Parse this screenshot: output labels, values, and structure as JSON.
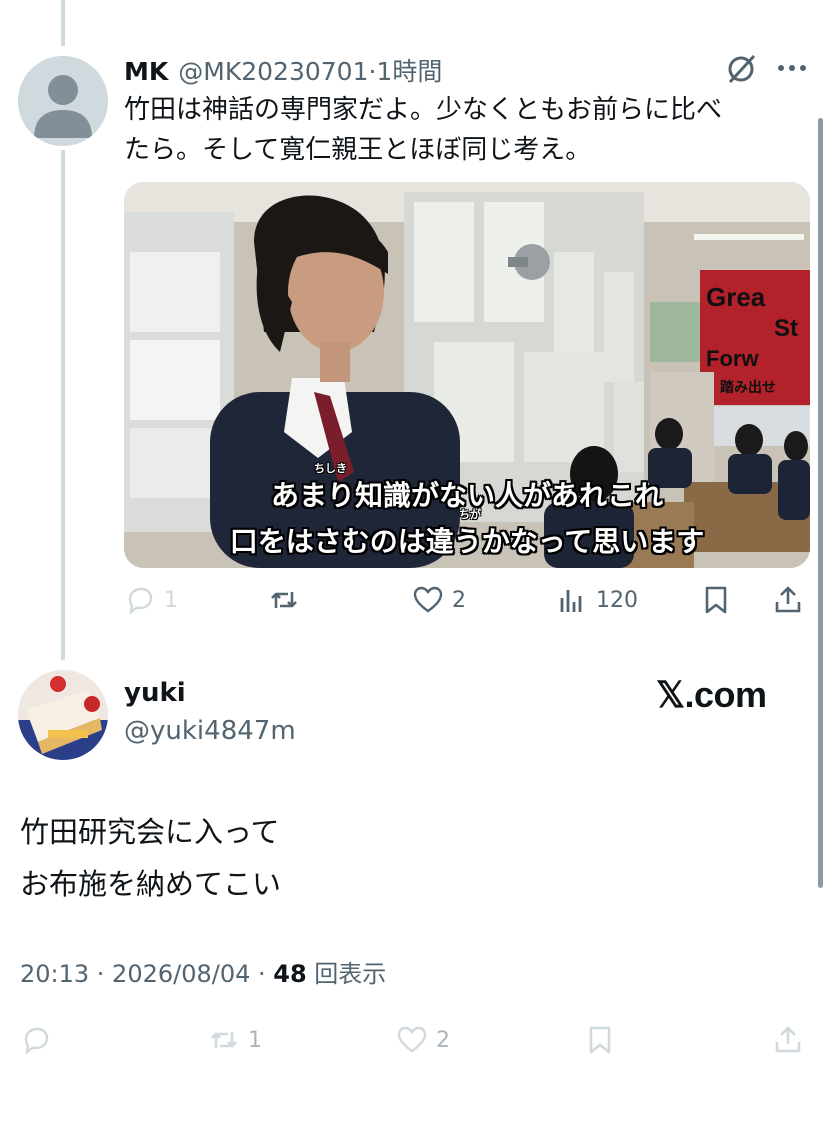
{
  "reply": {
    "name": "MK",
    "handle": "@MK20230701",
    "separator": "·",
    "time": "1時間",
    "text_line1": "竹田は神話の専門家だよ。少なくともお前らに比べ",
    "text_line2": "たら。そして寛仁親王とほぼ同じ考え。",
    "media": {
      "subtitle_line1": "あまり知識がない人があれこれ",
      "subtitle_line2": "口をはさむのは違うかなって思います",
      "ruby_chishiki": "ちしき",
      "ruby_chiga": "ちが",
      "banner_text1": "Grea",
      "banner_text2": "St",
      "banner_text3": "Forw",
      "banner_text4": "踏み出せ"
    },
    "actions": {
      "reply_count": "1",
      "repost_count": "",
      "like_count": "2",
      "views_count": "120"
    }
  },
  "original": {
    "name": "yuki",
    "handle": "@yuki4847m",
    "watermark": "𝕏.com",
    "text_line1": "竹田研究会に入って",
    "text_line2": "お布施を納めてこい",
    "time": "20:13 · 2026/08/04 · ",
    "views_number": "48",
    "views_label": " 回表示",
    "actions": {
      "repost_count": "1",
      "like_count": "2"
    }
  },
  "icons": {
    "avatar": "default-avatar-icon",
    "grok": "grok-icon",
    "more": "more-icon",
    "reply": "reply-icon",
    "repost": "repost-icon",
    "like": "heart-icon",
    "views": "views-icon",
    "bookmark": "bookmark-icon",
    "share": "share-icon"
  },
  "colors": {
    "text": "#0f1419",
    "secondary": "#536471",
    "thread_line": "#cfd9de",
    "muted_icon": "#cfd9de"
  }
}
